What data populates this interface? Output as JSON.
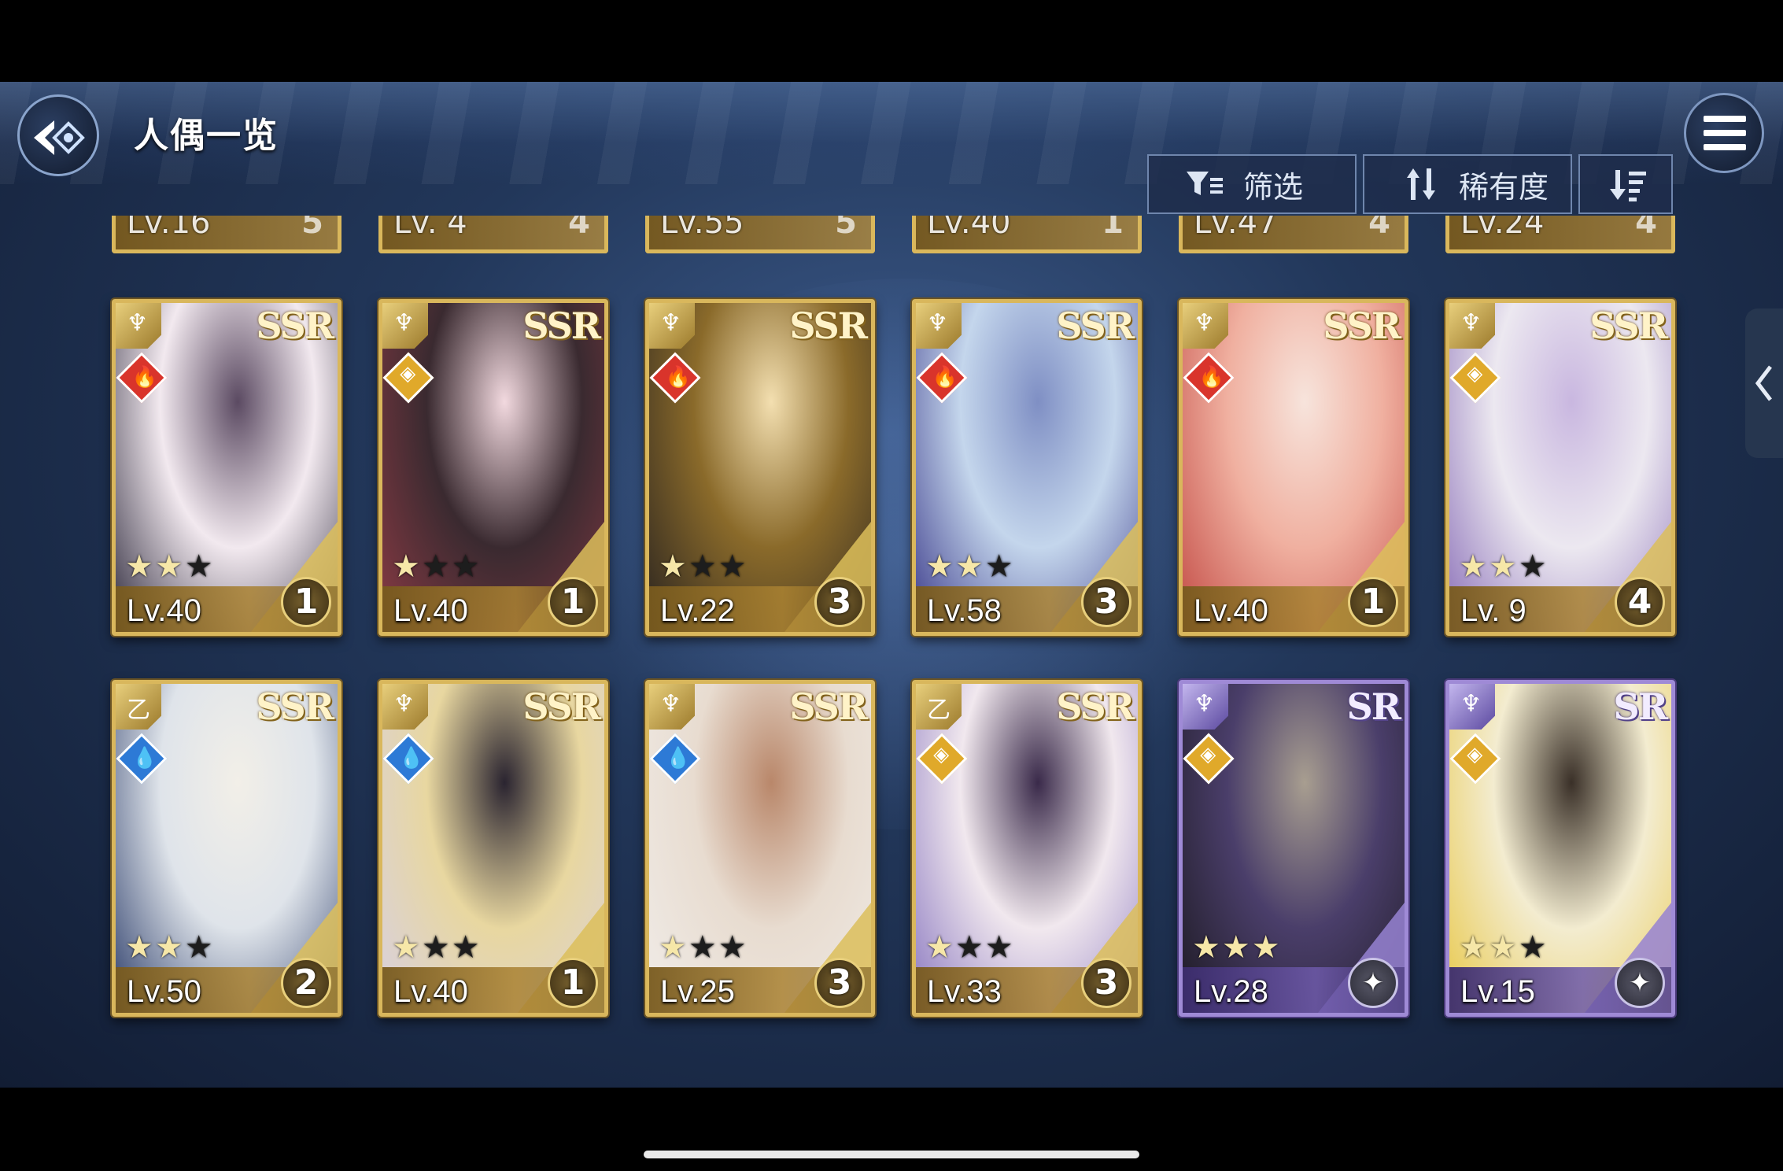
{
  "header": {
    "title": "人偶一览",
    "filter_label": "筛选",
    "sort_label": "稀有度"
  },
  "partial_row": [
    {
      "level": "Lv.16",
      "count": "5"
    },
    {
      "level": "Lv. 4",
      "count": "4"
    },
    {
      "level": "Lv.55",
      "count": "5"
    },
    {
      "level": "Lv.40",
      "count": "1"
    },
    {
      "level": "Lv.47",
      "count": "4"
    },
    {
      "level": "Lv.24",
      "count": "4"
    }
  ],
  "cards": [
    {
      "rarity": "SSR",
      "element": "fire",
      "element_glyph": "🔥",
      "class_glyph": "♆",
      "stars_on": 2,
      "stars_total": 3,
      "level": "Lv.40",
      "count": "1",
      "art": [
        "#f2e9ef",
        "#5b4a62",
        "#2f2b3d"
      ]
    },
    {
      "rarity": "SSR",
      "element": "light",
      "element_glyph": "◈",
      "class_glyph": "♆",
      "stars_on": 1,
      "stars_total": 3,
      "level": "Lv.40",
      "count": "1",
      "art": [
        "#3a2a30",
        "#f2d9df",
        "#8a3a44"
      ]
    },
    {
      "rarity": "SSR",
      "element": "fire",
      "element_glyph": "🔥",
      "class_glyph": "♆",
      "stars_on": 1,
      "stars_total": 3,
      "level": "Lv.22",
      "count": "3",
      "art": [
        "#8a6a2a",
        "#f3dfb0",
        "#2a2420"
      ]
    },
    {
      "rarity": "SSR",
      "element": "fire",
      "element_glyph": "🔥",
      "class_glyph": "♆",
      "stars_on": 2,
      "stars_total": 3,
      "level": "Lv.58",
      "count": "3",
      "art": [
        "#c4d6ec",
        "#7f8fc4",
        "#3b3a8a"
      ]
    },
    {
      "rarity": "SSR",
      "element": "fire",
      "element_glyph": "🔥",
      "class_glyph": "♆",
      "stars_on": 0,
      "stars_total": 0,
      "level": "Lv.40",
      "count": "1",
      "art": [
        "#f0b0a0",
        "#f7e4dc",
        "#c24a44"
      ]
    },
    {
      "rarity": "SSR",
      "element": "light",
      "element_glyph": "◈",
      "class_glyph": "♆",
      "stars_on": 2,
      "stars_total": 3,
      "level": "Lv. 9",
      "count": "4",
      "art": [
        "#ece8f0",
        "#c9b7e0",
        "#8a6fb8"
      ]
    },
    {
      "rarity": "SSR",
      "element": "water",
      "element_glyph": "💧",
      "class_glyph": "乙",
      "stars_on": 2,
      "stars_total": 3,
      "level": "Lv.50",
      "count": "2",
      "art": [
        "#dfe4ea",
        "#f2efe8",
        "#2c3d6a"
      ]
    },
    {
      "rarity": "SSR",
      "element": "water",
      "element_glyph": "💧",
      "class_glyph": "♆",
      "stars_on": 1,
      "stars_total": 3,
      "level": "Lv.40",
      "count": "1",
      "art": [
        "#e8d7a0",
        "#2a2430",
        "#d8d0e0"
      ]
    },
    {
      "rarity": "SSR",
      "element": "water",
      "element_glyph": "💧",
      "class_glyph": "♆",
      "stars_on": 1,
      "stars_total": 3,
      "level": "Lv.25",
      "count": "3",
      "art": [
        "#e8dcd0",
        "#b9876a",
        "#f0ece8"
      ]
    },
    {
      "rarity": "SSR",
      "element": "light",
      "element_glyph": "◈",
      "class_glyph": "乙",
      "stars_on": 1,
      "stars_total": 3,
      "level": "Lv.33",
      "count": "3",
      "art": [
        "#f1e8ee",
        "#3a2a4a",
        "#8a78c0"
      ]
    },
    {
      "rarity": "SR",
      "element": "light",
      "element_glyph": "◈",
      "class_glyph": "♆",
      "stars_on": 3,
      "stars_total": 3,
      "level": "Lv.28",
      "count": "",
      "art": [
        "#4a3e6a",
        "#a89e90",
        "#1d1a22"
      ]
    },
    {
      "rarity": "SR",
      "element": "light",
      "element_glyph": "◈",
      "class_glyph": "♆",
      "stars_on": 2,
      "stars_total": 3,
      "level": "Lv.15",
      "count": "",
      "art": [
        "#f3ecd0",
        "#3a3028",
        "#e8c84a"
      ]
    }
  ],
  "colors": {
    "gold_frame": "#d9b75c",
    "sr_frame": "#9f8ad6",
    "fire": "#d9342b",
    "water": "#2d7ad6",
    "light": "#e0a92a"
  }
}
